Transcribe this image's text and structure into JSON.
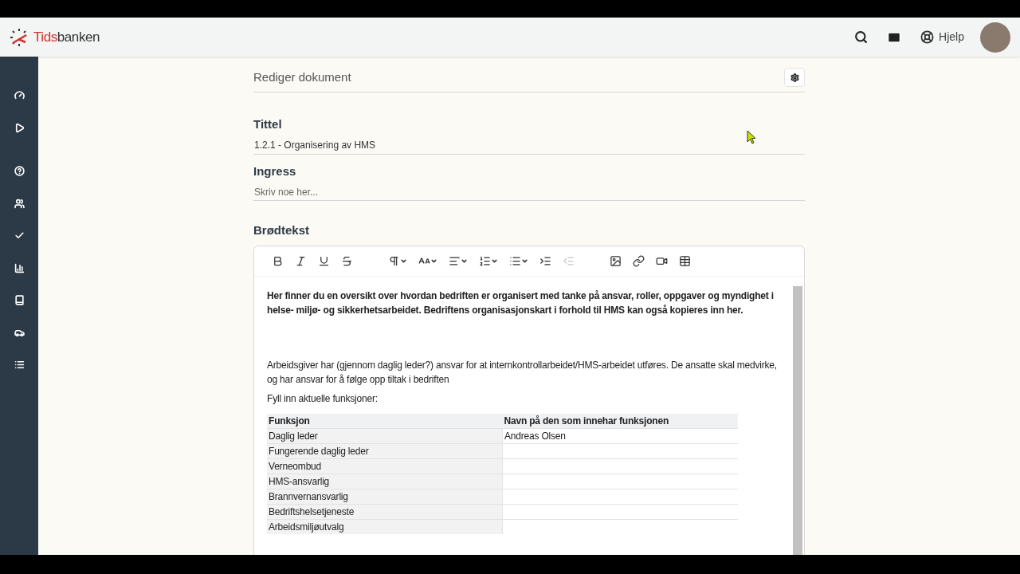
{
  "header": {
    "brand_prefix": "Tids",
    "brand_suffix": "banken",
    "help_label": "Hjelp"
  },
  "page": {
    "title": "Rediger dokument"
  },
  "fields": [
    {
      "label": "Tittel",
      "value": "1.2.1 - Organisering av HMS"
    },
    {
      "label": "Ingress",
      "placeholder": "Skriv noe her..."
    }
  ],
  "body": {
    "label": "Brødtekst",
    "toolbar": [
      {
        "dropdown": false,
        "disabled": false
      },
      {
        "dropdown": false,
        "disabled": false
      },
      {
        "dropdown": false,
        "disabled": false
      },
      {
        "dropdown": false,
        "disabled": false
      },
      {
        "dropdown": true,
        "disabled": false
      },
      {
        "dropdown": true,
        "disabled": false
      },
      {
        "dropdown": true,
        "disabled": false
      },
      {
        "dropdown": true,
        "disabled": false
      },
      {
        "dropdown": true,
        "disabled": false
      },
      {
        "dropdown": false,
        "disabled": false
      },
      {
        "dropdown": false,
        "disabled": true
      },
      {
        "dropdown": false,
        "disabled": false
      },
      {
        "dropdown": false,
        "disabled": false
      },
      {
        "dropdown": false,
        "disabled": false
      },
      {
        "dropdown": false,
        "disabled": false
      }
    ],
    "paragraphs": [
      {
        "text": "Her finner du en oversikt over hvordan bedriften er organisert med tanke på ansvar, roller, oppgaver og myndighet i helse- miljø- og sikkerhetsarbeidet. Bedriftens organisasjonskart i forhold til HMS kan også kopieres inn her.",
        "bold": true
      },
      {
        "text": "Arbeidsgiver har (gjennom daglig leder?) ansvar for at internkontrollarbeidet/HMS-arbeidet utføres. De ansatte skal medvirke, og har ansvar for å følge opp tiltak i bedriften",
        "bold": false
      },
      {
        "text": "Fyll inn aktuelle funksjoner:",
        "bold": false
      }
    ],
    "table": {
      "columns": [
        "Funksjon",
        "Navn på den som innehar funksjonen"
      ],
      "rows": [
        [
          "Daglig leder",
          "Andreas Olsen"
        ],
        [
          "Fungerende daglig leder",
          ""
        ],
        [
          "Verneombud",
          ""
        ],
        [
          "HMS-ansvarlig",
          ""
        ],
        [
          "Brannvernansvarlig",
          ""
        ],
        [
          "Bedriftshelsetjeneste",
          ""
        ],
        [
          "Arbeidsmiljøutvalg",
          ""
        ]
      ]
    }
  }
}
